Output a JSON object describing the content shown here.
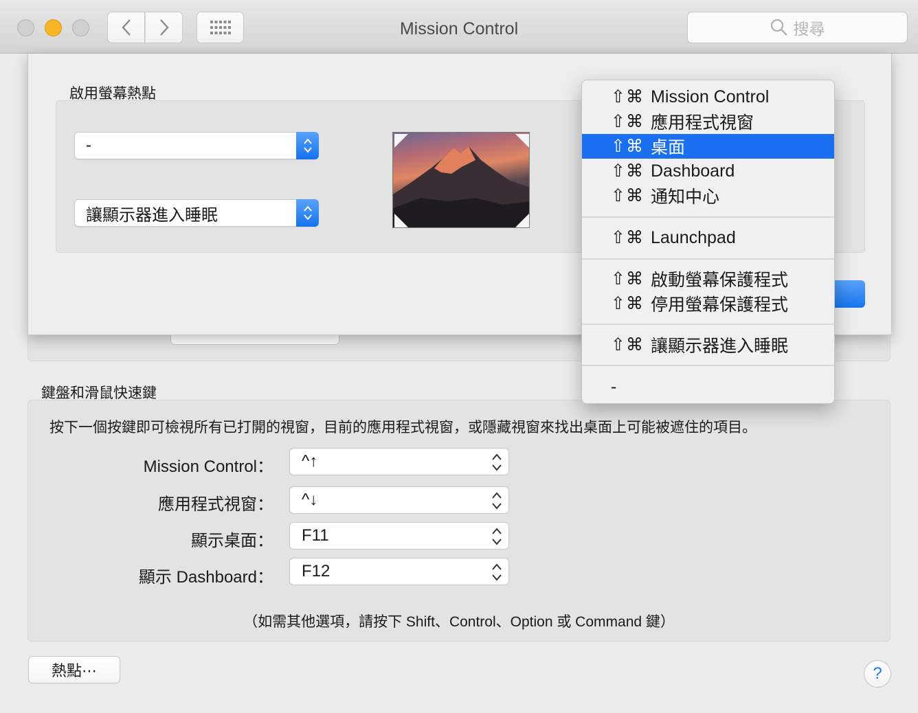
{
  "window": {
    "title": "Mission Control",
    "search_placeholder": "搜尋"
  },
  "sheet": {
    "label": "啟用螢幕熱點",
    "top_left_value": "-",
    "bottom_left_value": "讓顯示器進入睡眠"
  },
  "menu": {
    "modifier": "⇧⌘",
    "items": [
      {
        "label": "Mission Control"
      },
      {
        "label": "應用程式視窗"
      },
      {
        "label": "桌面",
        "selected": true
      },
      {
        "label": "Dashboard"
      },
      {
        "label": "通知中心"
      },
      {
        "label": "Launchpad"
      },
      {
        "label": "啟動螢幕保護程式"
      },
      {
        "label": "停用螢幕保護程式"
      },
      {
        "label": "讓顯示器進入睡眠"
      }
    ],
    "none_label": "-"
  },
  "keyboard": {
    "section_label": "鍵盤和滑鼠快速鍵",
    "description": "按下一個按鍵即可檢視所有已打開的視窗，目前的應用程式視窗，或隱藏視窗來找出桌面上可能被遮住的項目。",
    "rows": [
      {
        "label": "Mission Control：",
        "value": "^↑"
      },
      {
        "label": "應用程式視窗：",
        "value": "^↓"
      },
      {
        "label": "顯示桌面：",
        "value": "F11"
      },
      {
        "label": "顯示 Dashboard：",
        "value": "F12"
      }
    ],
    "hint": "（如需其他選項，請按下 Shift、Control、Option 或 Command 鍵）"
  },
  "buttons": {
    "hot_corners": "熱點⋯",
    "help": "?"
  },
  "colors": {
    "accent": "#1a6ff0",
    "minimize": "#f8b528"
  }
}
